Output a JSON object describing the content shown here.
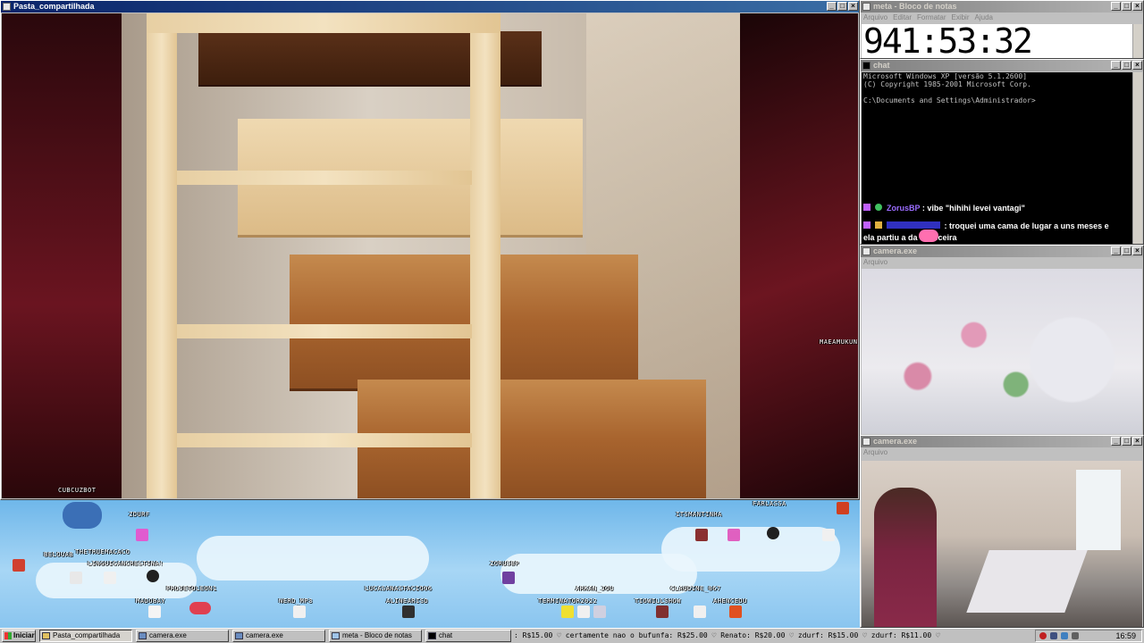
{
  "main_window": {
    "title": "Pasta_compartilhada"
  },
  "notepad": {
    "title": "meta - Bloco de notas",
    "menu": [
      "Arquivo",
      "Editar",
      "Formatar",
      "Exibir",
      "Ajuda"
    ],
    "clock_text": "941:53:32"
  },
  "chat_window": {
    "title": "chat",
    "console_lines": [
      "Microsoft Windows XP [versão 5.1.2600]",
      "(C) Copyright 1985-2001 Microsoft Corp.",
      "",
      "C:\\Documents and Settings\\Administrador>"
    ],
    "messages": [
      {
        "user": "ZorusBP",
        "text": ": vibe \"hihihi levei vantagi\""
      },
      {
        "user": "",
        "text": ": troquei uma cama de lugar a uns meses e"
      },
      {
        "user": "",
        "text": "ela partiu a      da cabeceira"
      }
    ]
  },
  "camera1": {
    "title": "camera.exe",
    "menu": "Arquivo"
  },
  "camera2": {
    "title": "camera.exe",
    "menu": "Arquivo"
  },
  "overlay_labels": {
    "right_side": "MAEAMUKUN",
    "main_bottom": "CUBCUZBOT"
  },
  "viewers": [
    "ZDURF",
    "BELOUAB",
    "THETRUEMACACO",
    "LINGUICANCRESTINA!",
    "PROJETOLEON1",
    "MADOBAY",
    "NERD_MP3",
    "LUCASANASTACIO06",
    "ALINEARISD",
    "ZORUSBP",
    "ARKAN_JOU",
    "TERMINATOR2022",
    "TIOWILLSHOW",
    "CLAUDINE_067",
    "AHENCEDU",
    "ITSMANTINHA",
    "FARLASSA"
  ],
  "taskbar": {
    "start_label": "Iniciar",
    "tasks": [
      "Pasta_compartilhada",
      "camera.exe",
      "camera.exe",
      "meta - Bloco de notas",
      "chat"
    ],
    "ticker": ": R$15.00 ♡  certamente nao o bufunfa: R$25.00 ♡  Renato: R$20.00 ♡  zdurf: R$15.00 ♡  zdurf: R$11.00 ♡",
    "clock": "16:59"
  }
}
